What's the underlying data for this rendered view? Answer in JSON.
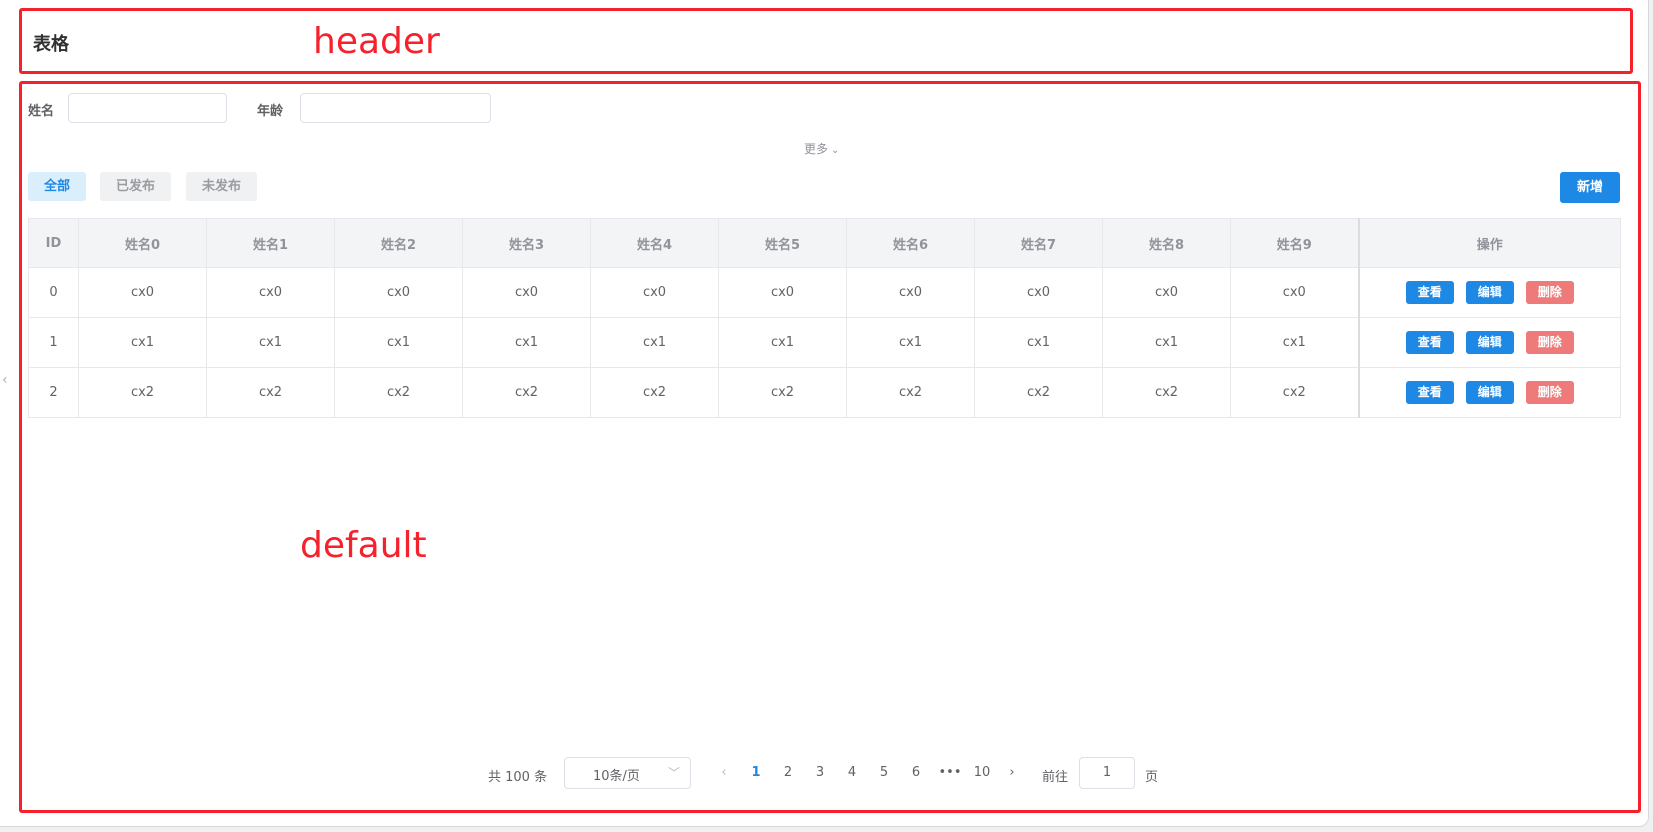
{
  "header": {
    "title": "表格"
  },
  "annotations": {
    "header_label": "header",
    "default_label": "default"
  },
  "search": {
    "fields": [
      {
        "label": "姓名",
        "value": ""
      },
      {
        "label": "年龄",
        "value": ""
      }
    ],
    "more_label": "更多"
  },
  "tabs": [
    {
      "label": "全部",
      "active": true
    },
    {
      "label": "已发布",
      "active": false
    },
    {
      "label": "未发布",
      "active": false
    }
  ],
  "toolbar": {
    "add_label": "新增"
  },
  "table": {
    "columns": [
      "ID",
      "姓名0",
      "姓名1",
      "姓名2",
      "姓名3",
      "姓名4",
      "姓名5",
      "姓名6",
      "姓名7",
      "姓名8",
      "姓名9",
      "操作"
    ],
    "rows": [
      {
        "id": "0",
        "cells": [
          "cx0",
          "cx0",
          "cx0",
          "cx0",
          "cx0",
          "cx0",
          "cx0",
          "cx0",
          "cx0",
          "cx0"
        ]
      },
      {
        "id": "1",
        "cells": [
          "cx1",
          "cx1",
          "cx1",
          "cx1",
          "cx1",
          "cx1",
          "cx1",
          "cx1",
          "cx1",
          "cx1"
        ]
      },
      {
        "id": "2",
        "cells": [
          "cx2",
          "cx2",
          "cx2",
          "cx2",
          "cx2",
          "cx2",
          "cx2",
          "cx2",
          "cx2",
          "cx2"
        ]
      }
    ],
    "actions": {
      "view": "查看",
      "edit": "编辑",
      "delete": "删除"
    }
  },
  "pagination": {
    "total_text": "共 100 条",
    "page_size": "10条/页",
    "pages": [
      "1",
      "2",
      "3",
      "4",
      "5",
      "6",
      "•••",
      "10"
    ],
    "current_page": "1",
    "goto_label": "前往",
    "goto_value": "1",
    "page_unit": "页"
  },
  "colors": {
    "primary": "#1e88e5",
    "danger": "#ef7a7a",
    "annotation": "#f5222d"
  }
}
